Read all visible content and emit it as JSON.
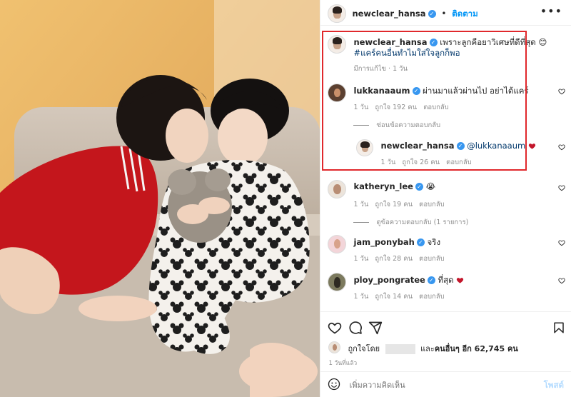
{
  "colors": {
    "accent": "#0095f6",
    "verified": "#3897f0",
    "highlight": "#e0282c",
    "heart": "#ed4956"
  },
  "post": {
    "author": "newclear_hansa",
    "separator": "•",
    "follow_label": "ติดตาม",
    "more_icon": "more-horizontal-icon"
  },
  "caption": {
    "username": "newclear_hansa",
    "text": "เพราะลูกคือยาวิเศษที่ดีที่สุด",
    "emoji": "😊",
    "hashtag": "#แคร์คนอื่นทำไมใส่ใจลูกก็พอ",
    "meta": "มีการแก้ไข · 1 วัน"
  },
  "comments": [
    {
      "username": "lukkanaaum",
      "text": "ผ่านมาแล้วผ่านไป อย่าได้แคร์",
      "time": "1 วัน",
      "likes": "ถูกใจ 192 คน",
      "reply_label": "ตอบกลับ",
      "replies_toggle": "ซ่อนข้อความตอบกลับ",
      "reply": {
        "username": "newclear_hansa",
        "mention": "@lukkanaaum",
        "time": "1 วัน",
        "likes": "ถูกใจ 26 คน",
        "reply_label": "ตอบกลับ"
      }
    },
    {
      "username": "katheryn_lee",
      "emoji": "😭",
      "time": "1 วัน",
      "likes": "ถูกใจ 19 คน",
      "reply_label": "ตอบกลับ",
      "replies_toggle": "ดูข้อความตอบกลับ (1 รายการ)"
    },
    {
      "username": "jam_ponybah",
      "text": "จริง",
      "time": "1 วัน",
      "likes": "ถูกใจ 28 คน",
      "reply_label": "ตอบกลับ"
    },
    {
      "username": "ploy_pongratee",
      "text": "ที่สุด",
      "time": "1 วัน",
      "likes": "ถูกใจ 14 คน",
      "reply_label": "ตอบกลับ"
    }
  ],
  "actions": {
    "like_icon": "heart-icon",
    "comment_icon": "comment-icon",
    "share_icon": "share-icon",
    "save_icon": "bookmark-icon"
  },
  "likes_summary": {
    "prefix": "ถูกใจโดย",
    "middle": "และ",
    "others_label": "คนอื่นๆ อีก 62,745 คน"
  },
  "posted_time": "1 วันที่แล้ว",
  "comment_box": {
    "placeholder": "เพิ่มความคิดเห็น",
    "post_label": "โพสต์",
    "emoji_icon": "smiley-icon"
  }
}
